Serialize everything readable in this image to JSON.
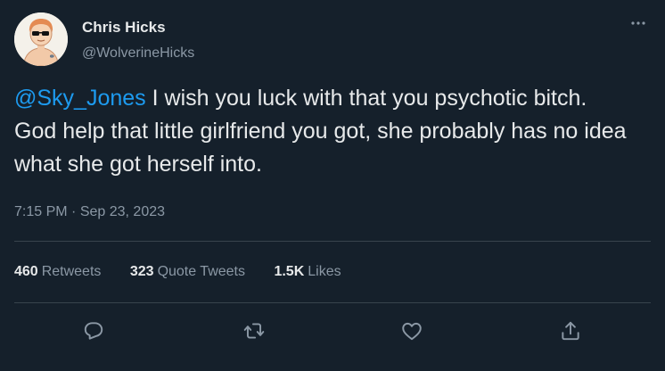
{
  "author": {
    "display_name": "Chris Hicks",
    "handle": "@WolverineHicks"
  },
  "tweet": {
    "mention": "@Sky_Jones",
    "text": " I wish you luck with that you psychotic bitch. God help that little girlfriend you got, she probably has no idea what she got herself into."
  },
  "meta": {
    "time": "7:15 PM",
    "separator": " · ",
    "date": "Sep 23, 2023"
  },
  "stats": [
    {
      "count": "460",
      "label": "Retweets"
    },
    {
      "count": "323",
      "label": "Quote Tweets"
    },
    {
      "count": "1.5K",
      "label": "Likes"
    }
  ],
  "actions": {
    "icons": [
      "reply-icon",
      "retweet-icon",
      "like-icon",
      "share-icon"
    ]
  },
  "colors": {
    "background": "#15202b",
    "text": "#e7e9ea",
    "secondary_text": "#8b98a5",
    "link": "#1d9bf0",
    "divider": "#38444d"
  }
}
